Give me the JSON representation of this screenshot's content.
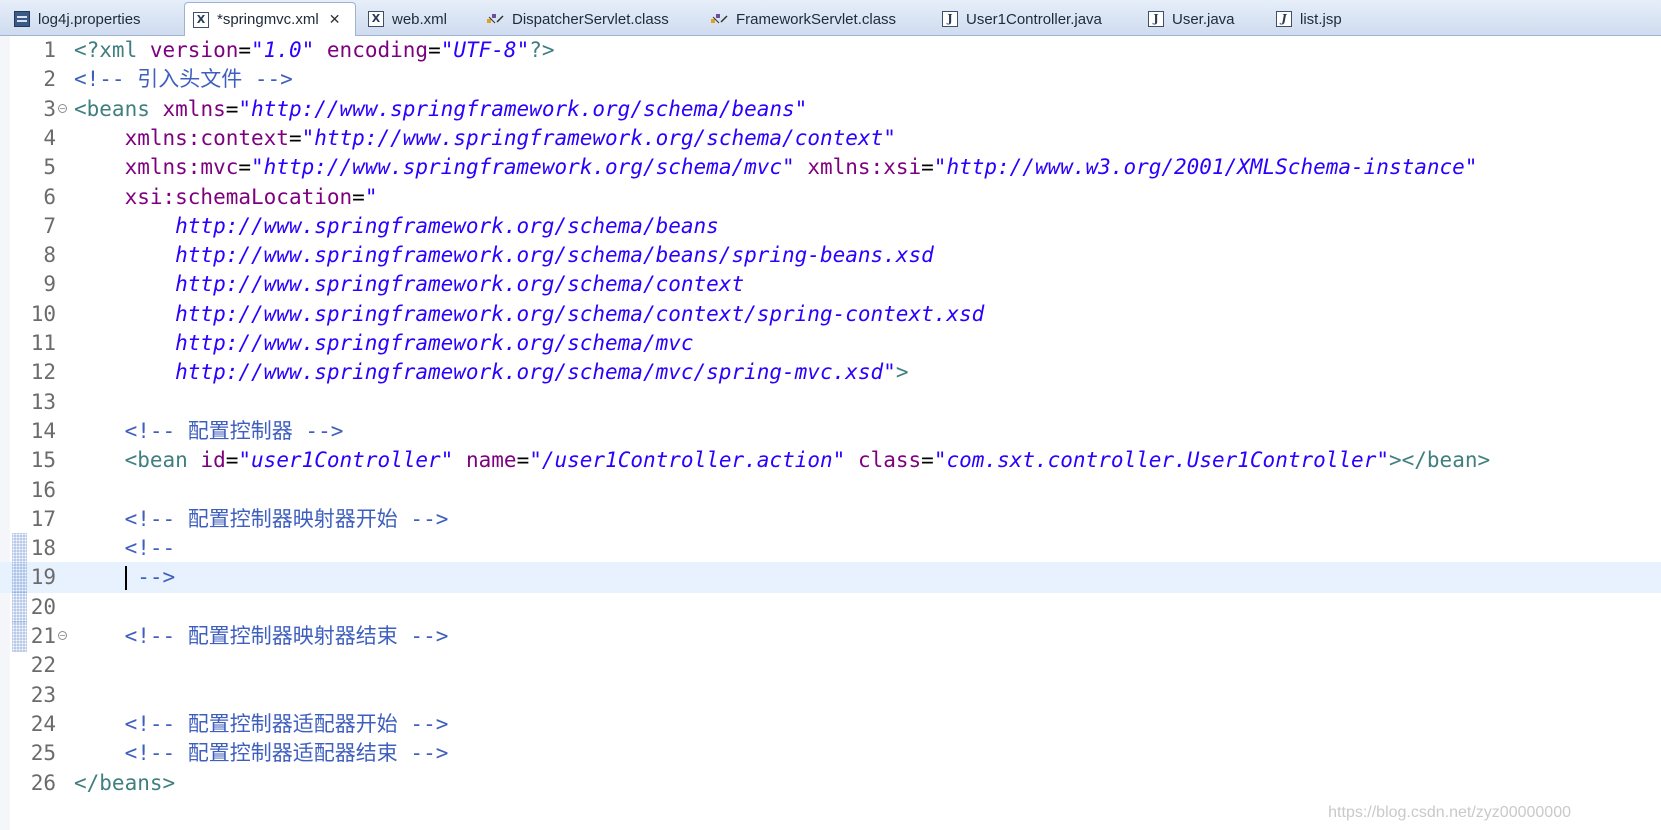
{
  "tabs": [
    {
      "label": "log4j.properties",
      "icon": "properties-file-icon",
      "active": false
    },
    {
      "label": "*springmvc.xml",
      "icon": "xml-file-icon",
      "active": true,
      "close": "✕"
    },
    {
      "label": "web.xml",
      "icon": "xml-file-icon",
      "active": false
    },
    {
      "label": "DispatcherServlet.class",
      "icon": "class-file-icon",
      "active": false
    },
    {
      "label": "FrameworkServlet.class",
      "icon": "class-file-icon",
      "active": false
    },
    {
      "label": "User1Controller.java",
      "icon": "java-file-icon",
      "active": false
    },
    {
      "label": "User.java",
      "icon": "java-file-icon",
      "active": false
    },
    {
      "label": "list.jsp",
      "icon": "jsp-file-icon",
      "active": false
    }
  ],
  "editor": {
    "current_line": 19,
    "lines": [
      {
        "n": "1",
        "tokens": [
          [
            "tag",
            "<?xml "
          ],
          [
            "attr",
            "version"
          ],
          [
            "p",
            "="
          ],
          [
            "val",
            "\"1.0\""
          ],
          [
            "p",
            " "
          ],
          [
            "attr",
            "encoding"
          ],
          [
            "p",
            "="
          ],
          [
            "val",
            "\"UTF-8\""
          ],
          [
            "tag",
            "?>"
          ]
        ]
      },
      {
        "n": "2",
        "tokens": [
          [
            "cmt",
            "<!-- 引入头文件 -->"
          ]
        ]
      },
      {
        "n": "3",
        "fold": true,
        "tokens": [
          [
            "tag",
            "<beans "
          ],
          [
            "attr",
            "xmlns"
          ],
          [
            "p",
            "="
          ],
          [
            "val",
            "\"http://www.springframework.org/schema/beans\""
          ]
        ]
      },
      {
        "n": "4",
        "tokens": [
          [
            "p",
            "    "
          ],
          [
            "attr",
            "xmlns:context"
          ],
          [
            "p",
            "="
          ],
          [
            "val",
            "\"http://www.springframework.org/schema/context\""
          ]
        ]
      },
      {
        "n": "5",
        "tokens": [
          [
            "p",
            "    "
          ],
          [
            "attr",
            "xmlns:mvc"
          ],
          [
            "p",
            "="
          ],
          [
            "val",
            "\"http://www.springframework.org/schema/mvc\""
          ],
          [
            "p",
            " "
          ],
          [
            "attr",
            "xmlns:xsi"
          ],
          [
            "p",
            "="
          ],
          [
            "val",
            "\"http://www.w3.org/2001/XMLSchema-instance\""
          ]
        ]
      },
      {
        "n": "6",
        "tokens": [
          [
            "p",
            "    "
          ],
          [
            "attr",
            "xsi:schemaLocation"
          ],
          [
            "p",
            "="
          ],
          [
            "val",
            "\""
          ]
        ]
      },
      {
        "n": "7",
        "tokens": [
          [
            "val",
            "        http://www.springframework.org/schema/beans"
          ]
        ]
      },
      {
        "n": "8",
        "tokens": [
          [
            "val",
            "        http://www.springframework.org/schema/beans/spring-beans.xsd"
          ]
        ]
      },
      {
        "n": "9",
        "tokens": [
          [
            "val",
            "        http://www.springframework.org/schema/context"
          ]
        ]
      },
      {
        "n": "10",
        "tokens": [
          [
            "val",
            "        http://www.springframework.org/schema/context/spring-context.xsd"
          ]
        ]
      },
      {
        "n": "11",
        "tokens": [
          [
            "val",
            "        http://www.springframework.org/schema/mvc"
          ]
        ]
      },
      {
        "n": "12",
        "tokens": [
          [
            "val",
            "        http://www.springframework.org/schema/mvc/spring-mvc.xsd\""
          ],
          [
            "tag",
            ">"
          ]
        ]
      },
      {
        "n": "13",
        "tokens": []
      },
      {
        "n": "14",
        "tokens": [
          [
            "p",
            "    "
          ],
          [
            "cmt",
            "<!-- 配置控制器 -->"
          ]
        ]
      },
      {
        "n": "15",
        "tokens": [
          [
            "p",
            "    "
          ],
          [
            "tag",
            "<bean "
          ],
          [
            "attr",
            "id"
          ],
          [
            "p",
            "="
          ],
          [
            "val",
            "\"user1Controller\""
          ],
          [
            "p",
            " "
          ],
          [
            "attr",
            "name"
          ],
          [
            "p",
            "="
          ],
          [
            "val",
            "\"/user1Controller.action\""
          ],
          [
            "p",
            " "
          ],
          [
            "attr",
            "class"
          ],
          [
            "p",
            "="
          ],
          [
            "val",
            "\"com.sxt.controller.User1Controller\""
          ],
          [
            "tag",
            "></bean>"
          ]
        ]
      },
      {
        "n": "16",
        "tokens": []
      },
      {
        "n": "17",
        "tokens": [
          [
            "p",
            "    "
          ],
          [
            "cmt",
            "<!-- 配置控制器映射器开始 -->"
          ]
        ]
      },
      {
        "n": "18",
        "mark": true,
        "tokens": [
          [
            "p",
            "    "
          ],
          [
            "cmt",
            "<!--"
          ]
        ]
      },
      {
        "n": "19",
        "mark": true,
        "caret": true,
        "tokens": [
          [
            "p",
            "    "
          ],
          [
            "cmt",
            " -->"
          ]
        ]
      },
      {
        "n": "20",
        "mark": true,
        "tokens": []
      },
      {
        "n": "21",
        "mark": true,
        "fold": true,
        "tokens": [
          [
            "p",
            "    "
          ],
          [
            "cmt",
            "<!-- 配置控制器映射器结束 -->"
          ]
        ]
      },
      {
        "n": "22",
        "tokens": []
      },
      {
        "n": "23",
        "tokens": []
      },
      {
        "n": "24",
        "tokens": [
          [
            "p",
            "    "
          ],
          [
            "cmt",
            "<!-- 配置控制器适配器开始 -->"
          ]
        ]
      },
      {
        "n": "25",
        "tokens": [
          [
            "p",
            "    "
          ],
          [
            "cmt",
            "<!-- 配置控制器适配器结束 -->"
          ]
        ]
      },
      {
        "n": "26",
        "tokens": [
          [
            "tag",
            "</beans>"
          ]
        ]
      }
    ]
  },
  "watermark": "https://blog.csdn.net/zyz00000000"
}
